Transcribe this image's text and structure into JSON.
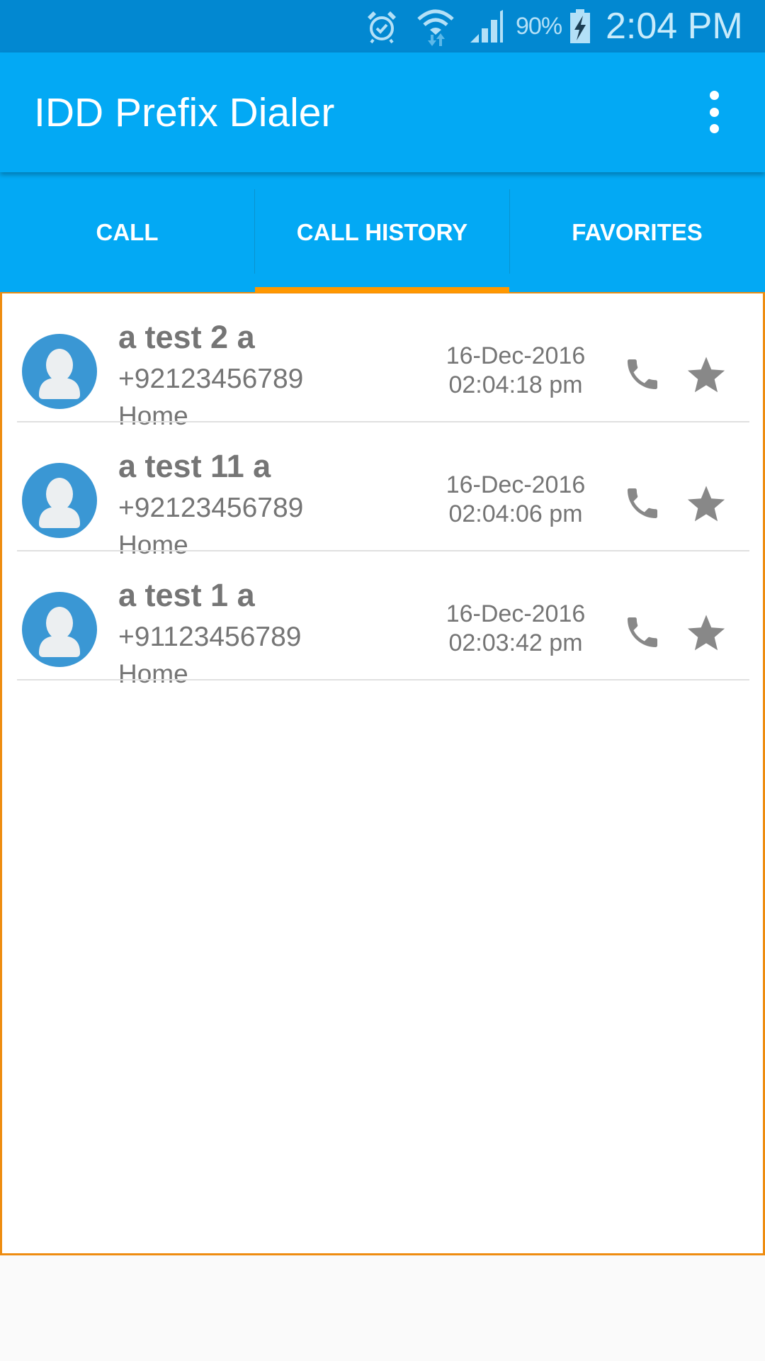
{
  "status_bar": {
    "icons": [
      "alarm-icon",
      "wifi-icon",
      "signal-icon",
      "battery-charging-icon"
    ],
    "battery_percent": "90%",
    "time": "2:04 PM"
  },
  "app_bar": {
    "title": "IDD Prefix Dialer",
    "overflow_icon": "more-vert-icon"
  },
  "tabs": [
    {
      "label": "CALL",
      "selected": false
    },
    {
      "label": "CALL HISTORY",
      "selected": true
    },
    {
      "label": "FAVORITES",
      "selected": false
    }
  ],
  "colors": {
    "status_bar": "#0288d1",
    "primary": "#03a9f4",
    "accent": "#ff9800",
    "avatar": "#3a97d4",
    "text_secondary": "#757575",
    "icon_gray": "#888888"
  },
  "call_history": [
    {
      "name": "a test 2 a",
      "number": "+92123456789",
      "label": "Home",
      "date": "16-Dec-2016",
      "time": "02:04:18 pm"
    },
    {
      "name": "a test 11 a",
      "number": "+92123456789",
      "label": "Home",
      "date": "16-Dec-2016",
      "time": "02:04:06 pm"
    },
    {
      "name": "a test 1 a",
      "number": "+91123456789",
      "label": "Home",
      "date": "16-Dec-2016",
      "time": "02:03:42 pm"
    }
  ]
}
